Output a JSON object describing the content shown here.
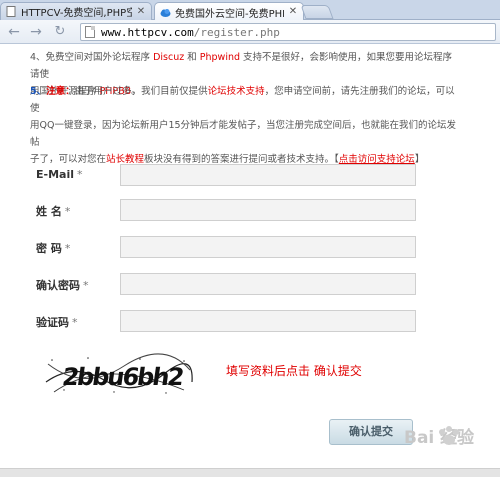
{
  "browser": {
    "tabs": [
      {
        "title": "HTTPCV-免费空间,PHP空间",
        "active": false
      },
      {
        "title": "免费国外云空间-免费PHP空间",
        "active": true
      }
    ],
    "url_host": "www.httpcv.com",
    "url_path": "/register.php"
  },
  "notice": {
    "item4_prefix": "4、免费空间对国外论坛程序 ",
    "discuz": "Discuz",
    "and": " 和 ",
    "phpwind": "Phpwind",
    "item4_suffix": " 支持不是很好，会影响使用，如果您要用论坛程序请使",
    "item4_line2_prefix": "用国外开源程序 ",
    "phpbb": "PHPBB",
    "item4_line2_suffix": "。",
    "item5_num": "5、",
    "item5_note_label": "注意：",
    "item5_a": "由于用户过多，我们目前仅提供",
    "forum_support": "论坛技术支持",
    "item5_b": "，您申请空间前，请先注册我们的论坛，可以使",
    "item5_line2": "用QQ一键登录，因为论坛新用户15分钟后才能发帖子，当您注册完成空间后，也就能在我们的论坛发帖",
    "item5_line3_a": "子了，可以对您在",
    "site_tutorial": "站长教程",
    "item5_line3_b": "板块没有得到的答案进行提问或者技术支持。【",
    "support_link": "点击访问支持论坛",
    "item5_line3_c": "】"
  },
  "form": {
    "email_label": "E-Mail",
    "name_label": "姓  名",
    "password_label": "密  码",
    "confirm_label": "确认密码",
    "captcha_label": "验证码",
    "required_mark": "*",
    "email_value": "",
    "name_value": "",
    "password_value": "",
    "confirm_value": "",
    "captcha_value": ""
  },
  "captcha_text": "2bbu6bh2",
  "captcha_hint": "填写资料后点击 确认提交",
  "submit_label": "确认提交",
  "watermark_text": "Bai 经验",
  "colors": {
    "accent_red": "#e00000",
    "input_bg": "#f3f3f3",
    "button_bg": "#c9dbe4"
  }
}
